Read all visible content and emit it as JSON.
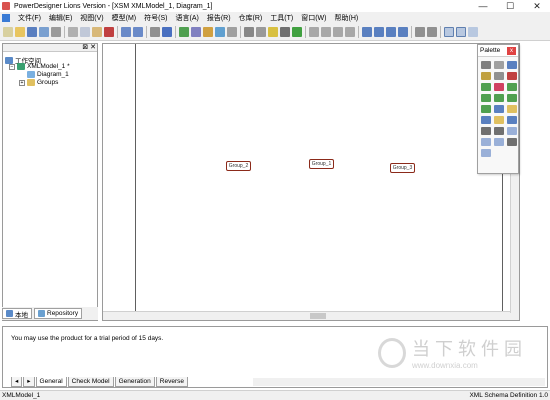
{
  "window": {
    "title": "PowerDesigner Lions Version - [XSM XMLModel_1, Diagram_1]",
    "controls": [
      "—",
      "☐",
      "✕"
    ]
  },
  "menubar": {
    "items": [
      "文件(F)",
      "编辑(E)",
      "视图(V)",
      "模型(M)",
      "符号(S)",
      "语言(A)",
      "报告(R)",
      "仓库(R)",
      "工具(T)",
      "窗口(W)",
      "帮助(H)"
    ]
  },
  "browser": {
    "workspace_label": "工作空间",
    "model_label": "XMLModel_1 *",
    "diagram_label": "Diagram_1",
    "groups_label": "Groups",
    "tabs": [
      "本地",
      "Repository"
    ]
  },
  "canvas": {
    "nodes": [
      "Group_2",
      "Group_1",
      "Group_3"
    ]
  },
  "palette": {
    "title": "Palette",
    "close_label": "x"
  },
  "output": {
    "message": "You may use the product for a trial period of 15 days.",
    "tabs": [
      "General",
      "Check Model",
      "Generation",
      "Reverse"
    ],
    "nav_arrows": [
      "◂",
      "▸"
    ]
  },
  "statusbar": {
    "left": "XMLModel_1",
    "right": "XML Schema Definition 1.0"
  },
  "watermark": {
    "text_cn": "当下软件园",
    "url": "www.downxia.com"
  },
  "colors": {
    "node_border": "#8b2a1a",
    "palette_close": "#e04343",
    "chrome": "#f0f0f0"
  }
}
